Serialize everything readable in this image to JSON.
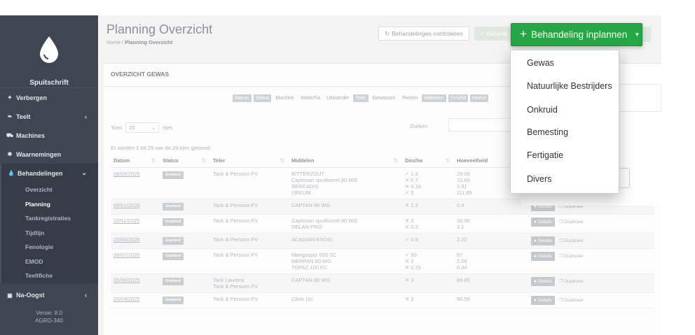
{
  "sidebar": {
    "brand": "Spuitschrift",
    "items": [
      {
        "label": "Verbergen",
        "icon": "magic-wand-icon"
      },
      {
        "label": "Teelt",
        "icon": "leaf-icon"
      },
      {
        "label": "Machines",
        "icon": "tractor-icon"
      },
      {
        "label": "Waarnemingen",
        "icon": "bug-icon"
      },
      {
        "label": "Behandelingen",
        "icon": "drop-icon"
      }
    ],
    "sub": [
      "Overzicht",
      "Planning",
      "Tankregistraties",
      "Tijdlijn",
      "Fenologie",
      "EMOD",
      "Teeltfiche"
    ],
    "na_oogst": "Na-Oogst",
    "version": "Versie: 8.0",
    "build": "AGRO-340"
  },
  "header": {
    "title": "Planning Overzicht",
    "crumb_home": "Home",
    "crumb_sep": "/",
    "crumb_current": "Planning Overzicht",
    "btn_check": "Behandelingen controleren",
    "btn_gepland": "✓ Behand"
  },
  "panel": {
    "title": "OVERZICHT GEWAS",
    "columns": [
      {
        "label": "Datum",
        "on": true
      },
      {
        "label": "Status",
        "on": true
      },
      {
        "label": "Machine",
        "on": false
      },
      {
        "label": "Water/ha",
        "on": false
      },
      {
        "label": "Uitvoerder",
        "on": false
      },
      {
        "label": "Teler",
        "on": true
      },
      {
        "label": "Gewassen",
        "on": false
      },
      {
        "label": "Teelten",
        "on": false
      },
      {
        "label": "Middelen",
        "on": true
      },
      {
        "label": "Dos/ha",
        "on": true
      },
      {
        "label": "Hoeve",
        "on": true
      }
    ],
    "show_label": "Toon",
    "show_value": "25",
    "show_suffix": "rijen",
    "search_label": "Zoeken",
    "info": "Er worden 1 tot 25 van de 29 rijen getoond"
  },
  "table": {
    "headers": [
      "Datum",
      "Status",
      "Teler",
      "Middelen",
      "Dos/ha",
      "Hoeveelheid"
    ],
    "details_label": "Details",
    "duplicate_label": "Dupliceer",
    "rows": [
      {
        "date": "08/06/2026",
        "status": "Gepland",
        "teler": [
          "Tack & Persoon FV"
        ],
        "middelen": [
          "BITTERZOUT",
          "Captosan spuitkorrel 80 WG",
          "SERCADIS",
          "UREUM"
        ],
        "dos": [
          "✓ 1.3",
          "✕ 0.7",
          "✕ 0.18",
          "✓ 5"
        ],
        "hoev": [
          "29.08",
          "15.66",
          "3.91",
          "111.85"
        ],
        "actions": false
      },
      {
        "date": "08/01/2026",
        "status": "Gepland",
        "teler": [
          "Tack & Persoon FV"
        ],
        "middelen": [
          "CAPTAN 80 WG"
        ],
        "dos": [
          "✕ 1.2"
        ],
        "hoev": [
          "0.4"
        ],
        "actions": true
      },
      {
        "date": "10/11/2025",
        "status": "Gepland",
        "teler": [
          "Tack & Persoon FV"
        ],
        "middelen": [
          "Captosan spuitkorrel 80 WG",
          "DELAN PRO"
        ],
        "dos": [
          "✕ 2",
          "✕ 0.2"
        ],
        "hoev": [
          "30.96",
          "3.1"
        ],
        "actions": true
      },
      {
        "date": "20/08/2025",
        "status": "Gepland",
        "teler": [
          "Tack & Persoon FV"
        ],
        "middelen": [
          "ACADIAN EXCEL"
        ],
        "dos": [
          "✓ 0.8"
        ],
        "hoev": [
          "2.22"
        ],
        "actions": true
      },
      {
        "date": "30/07/2025",
        "status": "Gepland",
        "teler": [
          "Tack & Persoon FV"
        ],
        "middelen": [
          "Mangaspor 500 SC",
          "MERPAN 80 WG",
          "TOPAZ 100 EC"
        ],
        "dos": [
          "✓ 50",
          "✕ 2",
          "✕ 0.25"
        ],
        "hoev": [
          "67",
          "2.68",
          "0.34"
        ],
        "actions": true
      },
      {
        "date": "05/06/2025",
        "status": "Gepland",
        "teler": [
          "Tack Laurens",
          "Tack & Persoon FV"
        ],
        "middelen": [
          "CAPTAN 80 WG"
        ],
        "dos": [
          "✕ 3"
        ],
        "hoev": [
          "89.85"
        ],
        "actions": true
      },
      {
        "date": "20/03/2025",
        "status": "Gepland",
        "teler": [
          "Tack & Persoon FV"
        ],
        "middelen": [
          "Clinic Up"
        ],
        "dos": [
          "✕ 2"
        ],
        "hoev": [
          "90.56"
        ],
        "actions": true
      }
    ]
  },
  "dropdown": {
    "button_label": "Behandeling inplannen",
    "items": [
      "Gewas",
      "Natuurlijke Bestrijders",
      "Onkruid",
      "Bemesting",
      "Fertigatie",
      "Divers"
    ]
  },
  "overlay_fragment": "n",
  "colors": {
    "accent": "#26a745",
    "sidebar": "#3e4651"
  }
}
